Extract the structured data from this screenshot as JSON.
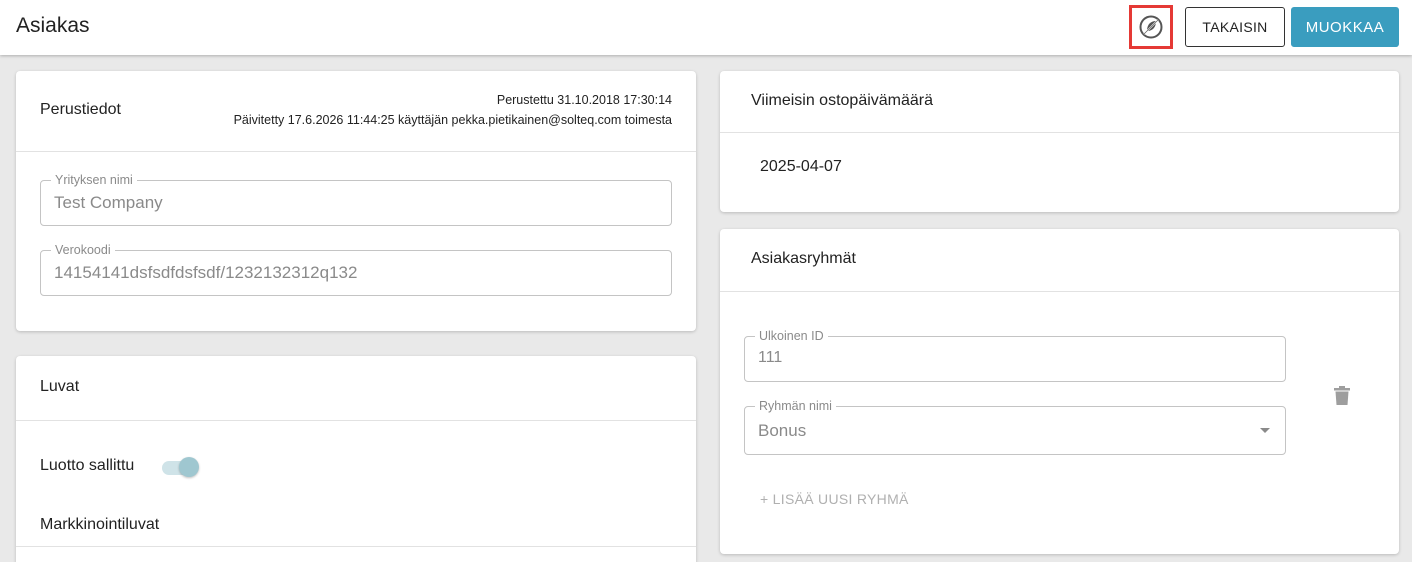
{
  "header": {
    "title": "Asiakas",
    "back_label": "TAKAISIN",
    "edit_label": "MUOKKAA",
    "toggle_icon": "disabled-leaf-icon"
  },
  "basic_info": {
    "title": "Perustiedot",
    "created": "Perustettu 31.10.2018 17:30:14",
    "updated": "Päivitetty 17.6.2026 11:44:25 käyttäjän pekka.pietikainen@solteq.com toimesta",
    "company_label": "Yrityksen nimi",
    "company_value": "Test Company",
    "tax_label": "Verokoodi",
    "tax_value": "14154141dsfsdfdsfsdf/1232132312q132"
  },
  "permissions": {
    "title": "Luvat",
    "credit_label": "Luotto sallittu",
    "credit_enabled": true,
    "marketing_title": "Markkinointiluvat"
  },
  "last_purchase": {
    "title": "Viimeisin ostopäivämäärä",
    "date": "2025-04-07"
  },
  "groups": {
    "title": "Asiakasryhmät",
    "external_id_label": "Ulkoinen ID",
    "external_id_value": "111",
    "group_name_label": "Ryhmän nimi",
    "group_name_value": "Bonus",
    "add_label": "+ LISÄÄ UUSI RYHMÄ"
  },
  "colors": {
    "primary": "#3a9dbf",
    "highlight": "#e53935",
    "background": "#e9e9e9"
  }
}
